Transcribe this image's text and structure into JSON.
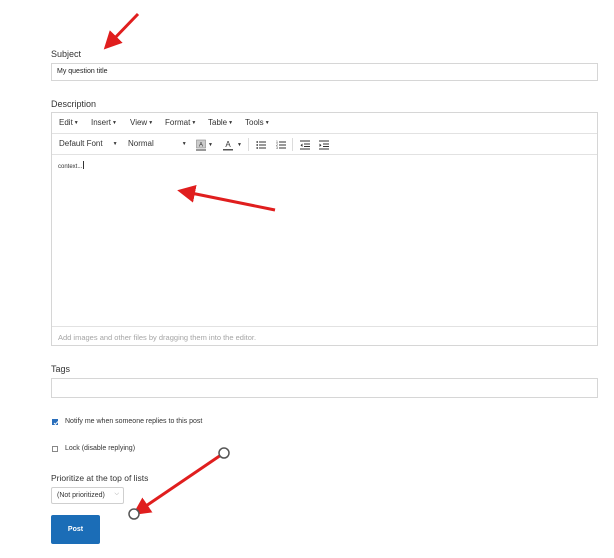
{
  "subject": {
    "label": "Subject",
    "value": "My question title"
  },
  "description": {
    "label": "Description",
    "menu": [
      "Edit",
      "Insert",
      "View",
      "Format",
      "Table",
      "Tools"
    ],
    "font": "Default Font",
    "size": "Normal",
    "body_text": "context...",
    "footer_hint": "Add images and other files by dragging them into the editor."
  },
  "tags": {
    "label": "Tags",
    "value": ""
  },
  "options": {
    "notify_label": "Notify me when someone replies to this post",
    "notify_checked": true,
    "lock_label": "Lock (disable replying)",
    "lock_checked": false
  },
  "priority": {
    "label": "Prioritize at the top of lists",
    "selected": "(Not prioritized)"
  },
  "actions": {
    "post_label": "Post"
  },
  "colors": {
    "accent": "#1b6db7",
    "annotation": "#e01e1e"
  },
  "icons": [
    "caret-down-icon",
    "background-color-icon",
    "text-color-icon",
    "bullet-list-icon",
    "numbered-list-icon",
    "outdent-icon",
    "indent-icon",
    "chevron-down-icon"
  ]
}
